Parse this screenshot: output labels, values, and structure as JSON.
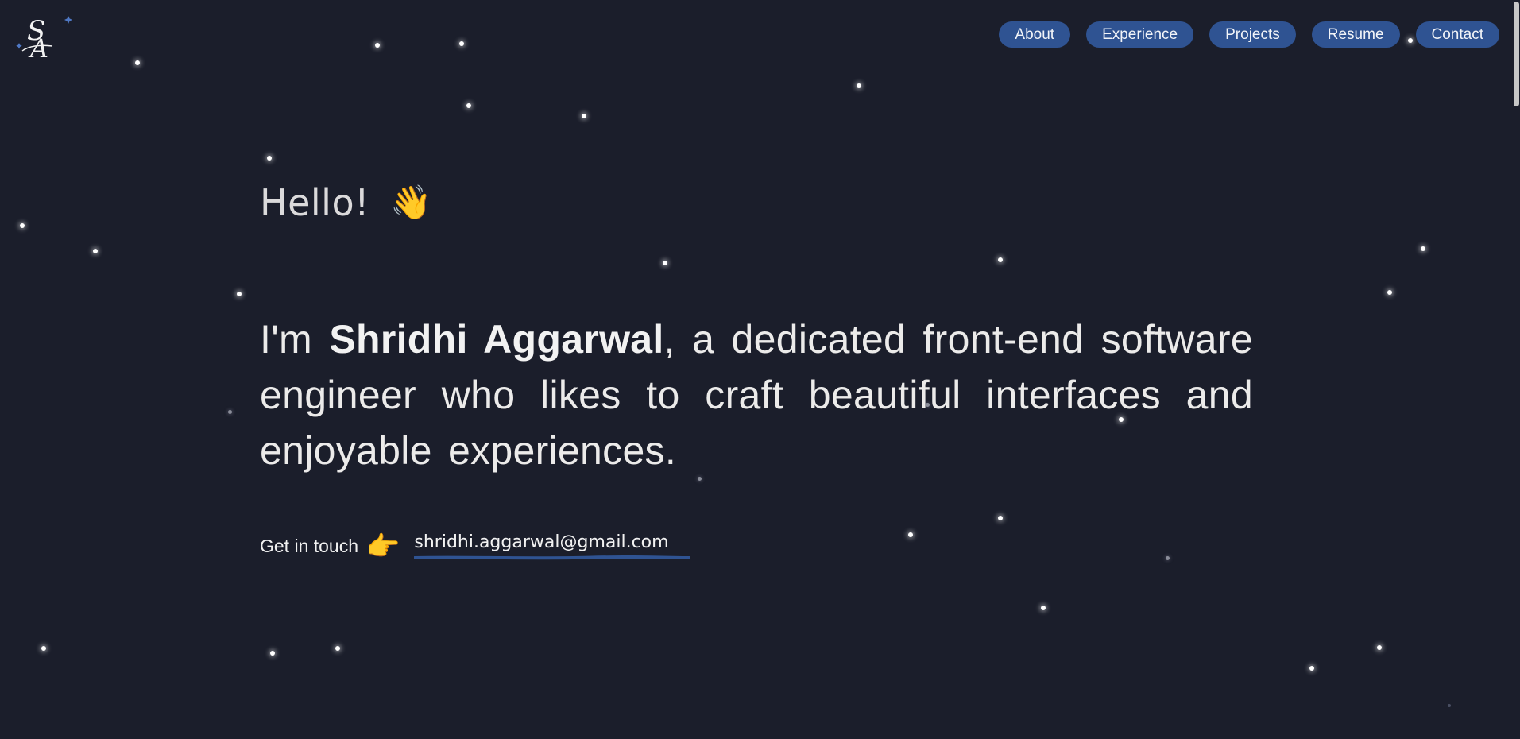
{
  "nav": {
    "items": [
      {
        "label": "About"
      },
      {
        "label": "Experience"
      },
      {
        "label": "Projects"
      },
      {
        "label": "Resume"
      },
      {
        "label": "Contact"
      }
    ]
  },
  "hero": {
    "greeting": "Hello!",
    "greeting_emoji": "👋",
    "intro_prefix": "I'm ",
    "name": "Shridhi Aggarwal",
    "intro_suffix": ", a dedicated front-end software engineer who likes to craft beautiful interfaces and enjoyable experiences.",
    "contact_label": "Get in touch",
    "contact_emoji": "👉",
    "email": "shridhi.aggarwal@gmail.com"
  },
  "colors": {
    "background": "#1b1e2b",
    "nav_pill": "#2f5392",
    "underline": "#2f5392",
    "text": "#ecebea"
  },
  "icons": {
    "logo": "sa-monogram-logo",
    "greeting": "waving-hand-icon",
    "contact": "pointing-hand-icon"
  }
}
